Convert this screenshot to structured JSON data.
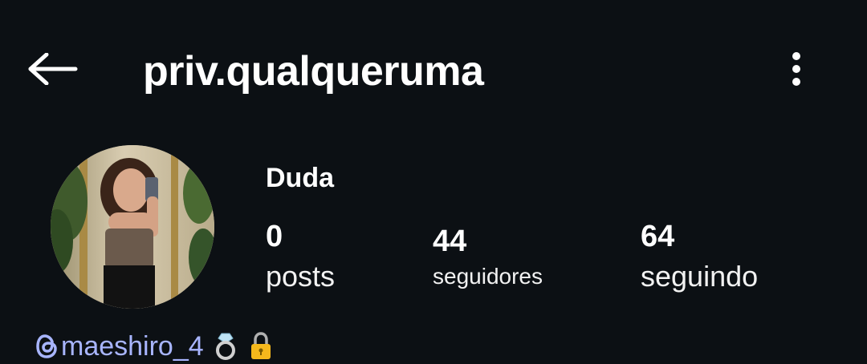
{
  "header": {
    "username": "priv.qualqueruma",
    "back_icon": "arrow-left-icon",
    "more_icon": "vertical-dots-icon"
  },
  "profile": {
    "avatar": "profile-photo",
    "display_name": "Duda",
    "stats": {
      "posts": {
        "count": "0",
        "label": "posts"
      },
      "followers": {
        "count": "44",
        "label": "seguidores"
      },
      "following": {
        "count": "64",
        "label": "seguindo"
      }
    },
    "bio": {
      "threads_handle": "maeshiro_4",
      "threads_icon": "threads-icon",
      "emojis": [
        "ring-icon",
        "lock-icon"
      ]
    }
  },
  "colors": {
    "background": "#0c1014",
    "text": "#ffffff",
    "link": "#a8b5ff"
  }
}
